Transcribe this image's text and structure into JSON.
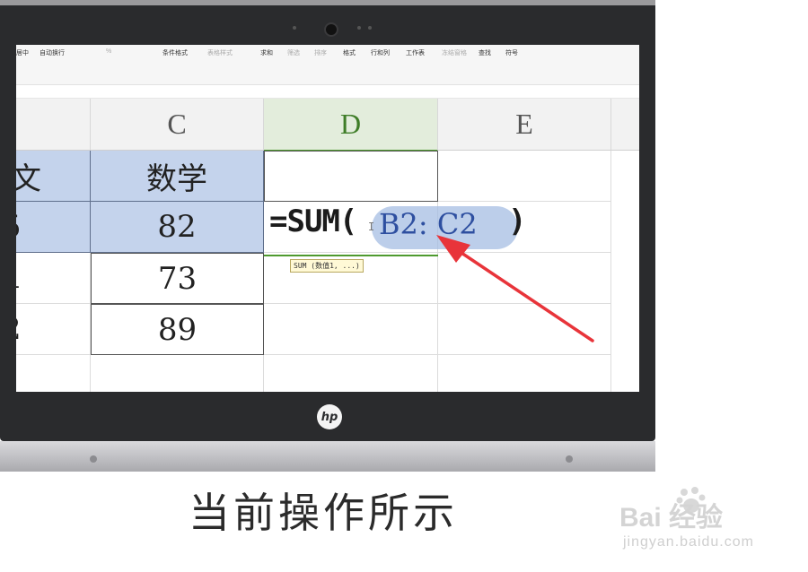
{
  "ribbon": {
    "items": [
      {
        "label": "居中",
        "dim": false
      },
      {
        "label": "自动换行",
        "dim": false
      },
      {
        "label": "%",
        "dim": true
      },
      {
        "label": "条件格式",
        "dim": false
      },
      {
        "label": "表格样式",
        "dim": true
      },
      {
        "label": "求和",
        "dim": false
      },
      {
        "label": "筛选",
        "dim": true
      },
      {
        "label": "排序",
        "dim": true
      },
      {
        "label": "格式",
        "dim": false
      },
      {
        "label": "行和列",
        "dim": false
      },
      {
        "label": "工作表",
        "dim": false
      },
      {
        "label": "冻结窗格",
        "dim": true
      },
      {
        "label": "查找",
        "dim": false
      },
      {
        "label": "符号",
        "dim": false
      }
    ]
  },
  "columns": {
    "c": "C",
    "d": "D",
    "e": "E"
  },
  "cells": {
    "b1": "文",
    "c1": "数学",
    "b2": "5",
    "c2": "82",
    "b3": "1",
    "c3": "73",
    "b4": "2",
    "c4": "89"
  },
  "formula": {
    "prefix": "=SUM(",
    "range": "B2: C2",
    "suffix": ")",
    "tooltip": "SUM (数值1, ...)"
  },
  "device": {
    "brand": "hp"
  },
  "caption": "当前操作所示",
  "watermark": {
    "brand": "Bai 经验",
    "sub": "jingyan.baidu.com"
  },
  "colors": {
    "arrow": "#e8343a",
    "selection": "#c4d3ec",
    "active_column": "#4e9a2e"
  }
}
